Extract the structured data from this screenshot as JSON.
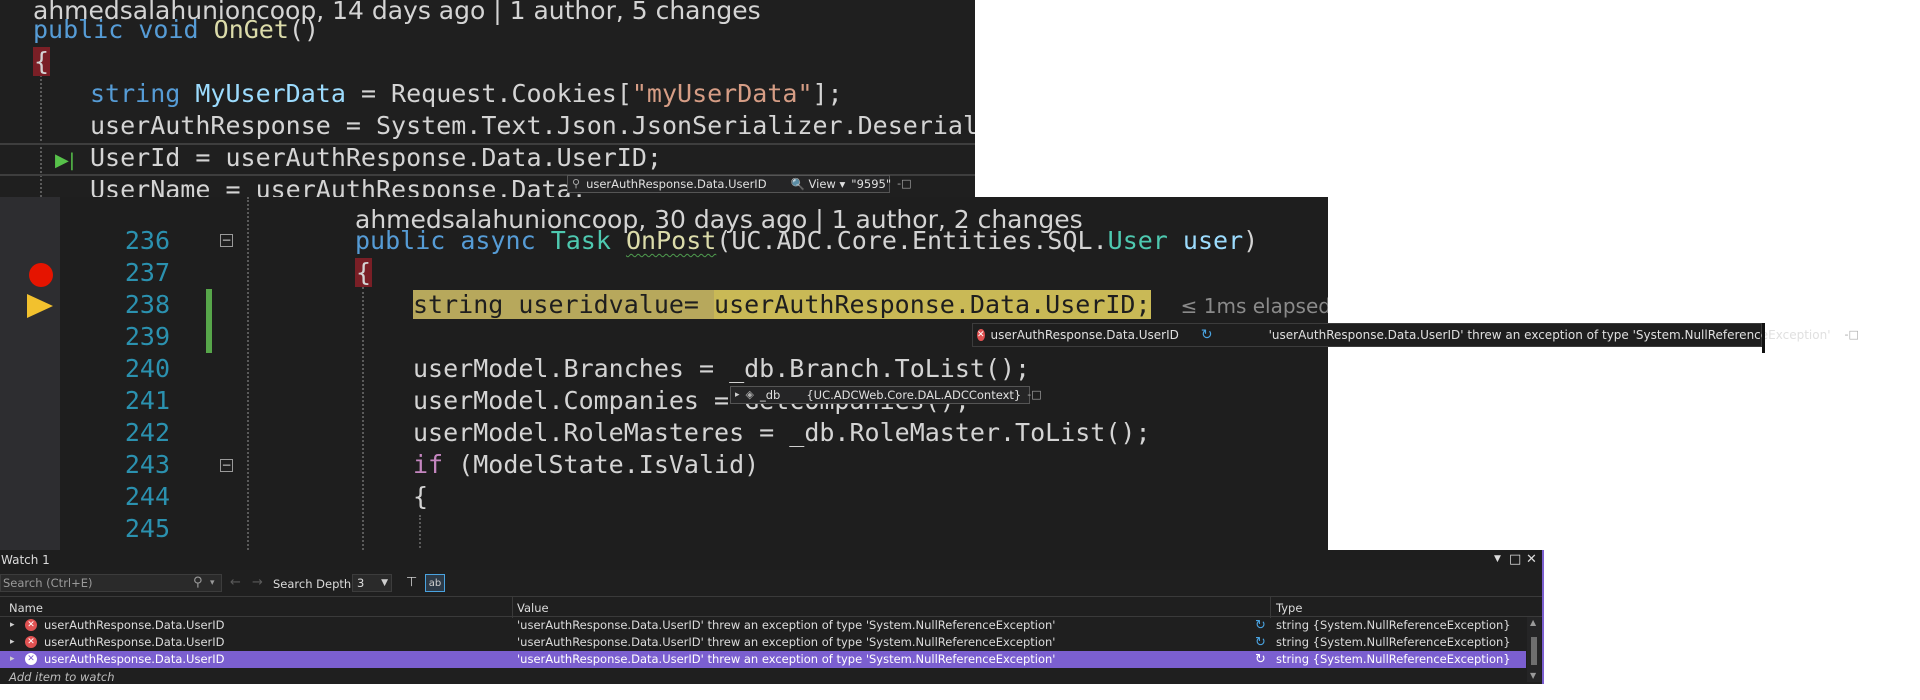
{
  "top_snippet": {
    "codelens": "ahmedsalahunioncoop, 14 days ago | 1 author, 5 changes",
    "lines": {
      "l1_kw": "public",
      "l1_kw2": "void",
      "l1_fn": "OnGet",
      "l1_rest": "()",
      "l2": "{",
      "l3_ty": "string",
      "l3_id": "MyUserData",
      "l3_a": " = Request.Cookies[",
      "l3_str": "\"myUserData\"",
      "l3_b": "];",
      "l4_a": "userAuthResponse = System.Text.Json.",
      "l4_ty": "JsonSerializer",
      "l4_b": ".Deserialize",
      "l5": "UserId = userAuthResponse.Data.UserID;",
      "l6": "UserName = userAuthResponse.Data."
    },
    "datatip": {
      "expr": "userAuthResponse.Data.UserID",
      "view": "View",
      "value": "\"9595\""
    }
  },
  "main_editor": {
    "codelens": "ahmedsalahunioncoop, 30 days ago | 1 author, 2 changes",
    "line_numbers": [
      "236",
      "237",
      "238",
      "239",
      "240",
      "241",
      "242",
      "243",
      "244",
      "245"
    ],
    "lines": {
      "l236_kw": "public",
      "l236_kw2": "async",
      "l236_ty": "Task",
      "l236_fn": "OnPost",
      "l236_a": "(UC.ADC.Core.Entities.SQL.",
      "l236_ty2": "User",
      "l236_id": "user",
      "l236_b": ")",
      "l237": "{",
      "l238_a": "string userid",
      "l238_b": "value= ",
      "l238_c": "userAuthResponse.Data.UserID;",
      "l238_elapsed": "≤ 1ms elapsed",
      "l240": "userModel.Branches = _db.Branch.ToList();",
      "l241": "userModel.Companies = GetCompanies();",
      "l242": "userModel.RoleMasteres = _db.RoleMaster.ToList();",
      "l243_kw": "if",
      "l243_rest": " (ModelState.IsValid)",
      "l244": "{"
    },
    "datatip_error": {
      "expr": "userAuthResponse.Data.UserID",
      "value": "'userAuthResponse.Data.UserID' threw an exception of type 'System.NullReferenceException'"
    },
    "datatip_db": {
      "expr": "_db",
      "value": "{UC.ADCWeb.Core.DAL.ADCContext}"
    }
  },
  "watch": {
    "title": "Watch 1",
    "search_placeholder": "Search (Ctrl+E)",
    "search_depth_label": "Search Depth:",
    "search_depth_value": "3",
    "columns": {
      "name": "Name",
      "value": "Value",
      "type": "Type"
    },
    "rows": [
      {
        "name": "userAuthResponse.Data.UserID",
        "value": "'userAuthResponse.Data.UserID' threw an exception of type 'System.NullReferenceException'",
        "type": "string {System.NullReferenceException}"
      },
      {
        "name": "userAuthResponse.Data.UserID",
        "value": "'userAuthResponse.Data.UserID' threw an exception of type 'System.NullReferenceException'",
        "type": "string {System.NullReferenceException}"
      },
      {
        "name": "userAuthResponse.Data.UserID",
        "value": "'userAuthResponse.Data.UserID' threw an exception of type 'System.NullReferenceException'",
        "type": "string {System.NullReferenceException}"
      }
    ],
    "add_item": "Add item to watch",
    "selection_color": "#7b5fd0"
  },
  "icons": [
    "pin-icon",
    "error-icon",
    "refresh-icon",
    "breakpoint-icon",
    "execution-arrow-icon",
    "search-icon",
    "back-arrow-icon",
    "forward-arrow-icon",
    "pin-filter-icon",
    "hex-toggle-icon"
  ]
}
